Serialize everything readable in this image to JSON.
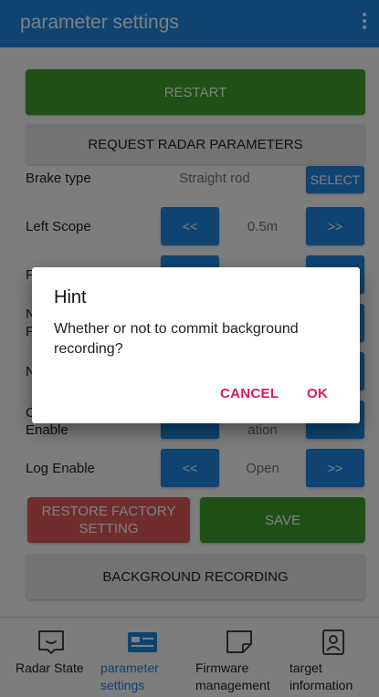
{
  "appbar": {
    "title": "parameter settings"
  },
  "main": {
    "restart_label": "RESTART",
    "request_label": "REQUEST RADAR PARAMETERS",
    "brake_type": {
      "label": "Brake type",
      "value": "Straight rod",
      "button": "SELECT"
    },
    "left_scope": {
      "label": "Left Scope",
      "value": "0.5m",
      "dec": "<<",
      "inc": ">>"
    },
    "hidden_rows": [
      {
        "label_fragment": "F",
        "value": ""
      },
      {
        "label_fragment": "N",
        "label_fragment2": "F",
        "value": ""
      },
      {
        "label_fragment": "N",
        "value": ""
      },
      {
        "label_fragment": "C",
        "label_tail": "Enable",
        "value": "ation"
      }
    ],
    "log_enable": {
      "label": "Log Enable",
      "value": "Open",
      "dec": "<<",
      "inc": ">>"
    },
    "restore_label": "RESTORE FACTORY SETTING",
    "save_label": "SAVE",
    "background_label": "BACKGROUND RECORDING"
  },
  "nav": {
    "items": [
      {
        "label": "Radar State",
        "icon": "chat-bubble-icon"
      },
      {
        "label": "parameter settings",
        "icon": "id-card-icon"
      },
      {
        "label": "Firmware management",
        "icon": "document-icon"
      },
      {
        "label": "target information",
        "icon": "person-icon"
      }
    ]
  },
  "dialog": {
    "title": "Hint",
    "message": "Whether or not to commit background recording?",
    "cancel": "CANCEL",
    "ok": "OK"
  },
  "colors": {
    "primary": "#1e88e5",
    "success": "#3fa22c",
    "danger": "#e05a5a",
    "accent": "#d81b60"
  }
}
